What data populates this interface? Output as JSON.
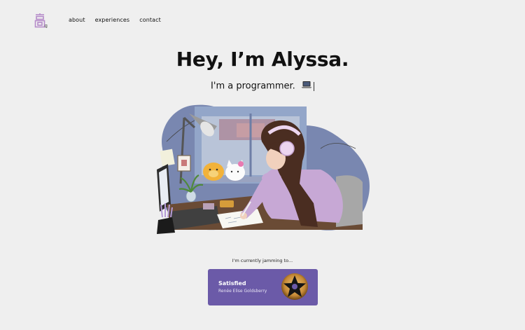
{
  "nav": {
    "logo_icon": "kanji-logo-icon",
    "links": [
      {
        "label": "about"
      },
      {
        "label": "experiences"
      },
      {
        "label": "contact"
      }
    ]
  },
  "hero": {
    "title": "Hey, I’m Alyssa.",
    "subtitle": "I'm a programmer.",
    "subtitle_icon": "laptop-emoji-icon",
    "illustration_icon": "girl-drawing-at-desk-illustration"
  },
  "now_playing": {
    "label": "I'm currently jamming to...",
    "song_title": "Satisfied",
    "artist": "Renée Elise Goldsberry",
    "card_color": "#6b5aa8",
    "album_art_icon": "hamilton-star-album-art-icon"
  },
  "colors": {
    "background": "#efefef",
    "accent": "#6b5aa8",
    "logo": "#b58bc9"
  }
}
